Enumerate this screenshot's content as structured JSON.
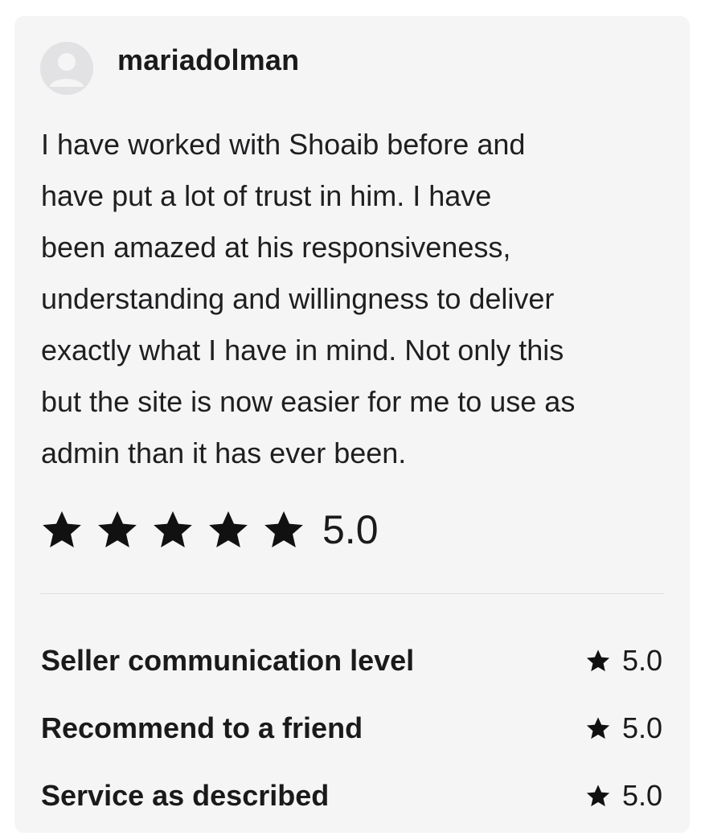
{
  "review": {
    "username": "mariadolman",
    "avatar_icon": "default-user-avatar-icon",
    "text": "I have worked with Shoaib before and\nhave put a lot of trust in him.  I have\nbeen amazed at his responsiveness,\nunderstanding and willingness to deliver\nexactly what I have in mind.  Not only this\nbut the site is now easier for me to use as\nadmin than it has ever been.",
    "overall_rating": "5.0",
    "overall_stars": 5
  },
  "sub_ratings": [
    {
      "label": "Seller communication level",
      "value": "5.0",
      "icon": "star-icon"
    },
    {
      "label": "Recommend to a friend",
      "value": "5.0",
      "icon": "star-icon"
    },
    {
      "label": "Service as described",
      "value": "5.0",
      "icon": "star-icon"
    }
  ],
  "colors": {
    "card_background": "#f5f5f5",
    "star": "#111111",
    "avatar_background": "#e2e2e4",
    "divider": "#dedede"
  }
}
